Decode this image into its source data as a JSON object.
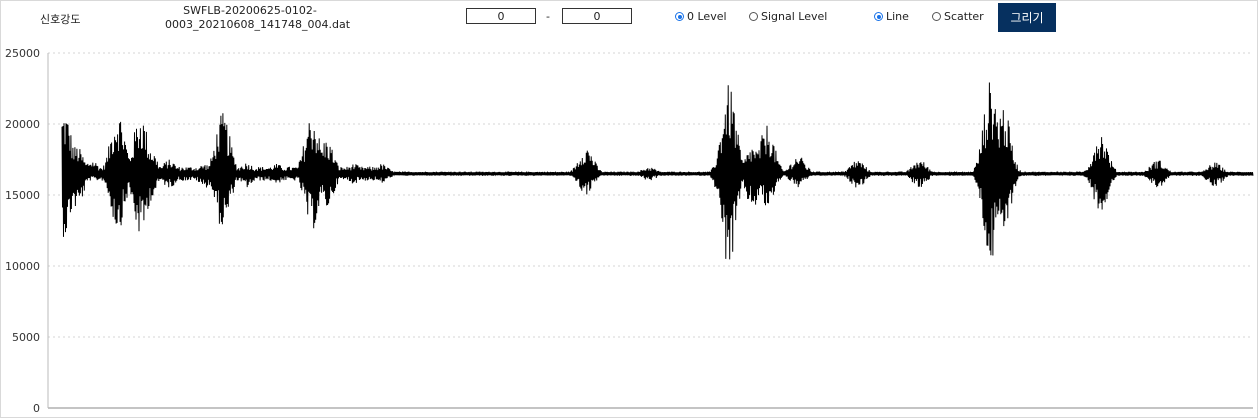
{
  "toolbar": {
    "title_label": "신호강도",
    "filename_line1": "SWFLB-20200625-0102-",
    "filename_line2": "0003_20210608_141748_004.dat",
    "range_start": "0",
    "range_separator": "-",
    "range_end": "0",
    "level_options": [
      "0 Level",
      "Signal Level"
    ],
    "level_selected": "0 Level",
    "plot_options": [
      "Line",
      "Scatter"
    ],
    "plot_selected": "Line",
    "draw_button": "그리기"
  },
  "colors": {
    "button_bg": "#06305f",
    "radio_checked": "#1a73e8",
    "signal": "#000000"
  },
  "chart_data": {
    "type": "line",
    "xlabel": "",
    "ylabel": "",
    "ylim": [
      0,
      25000
    ],
    "yticks": [
      "0",
      "5000",
      "10000",
      "15000",
      "20000",
      "25000"
    ],
    "grid": "horizontal-dotted",
    "baseline": 16500,
    "x_range": [
      0,
      1000
    ],
    "bursts": [
      {
        "x": 2,
        "min": 12000,
        "max": 21000
      },
      {
        "x": 12,
        "min": 14000,
        "max": 18500
      },
      {
        "x": 25,
        "min": 16000,
        "max": 17500
      },
      {
        "x": 47,
        "min": 12500,
        "max": 21000
      },
      {
        "x": 53,
        "min": 15500,
        "max": 17500
      },
      {
        "x": 66,
        "min": 12000,
        "max": 20800
      },
      {
        "x": 73,
        "min": 14500,
        "max": 18500
      },
      {
        "x": 90,
        "min": 15500,
        "max": 17500
      },
      {
        "x": 120,
        "min": 15500,
        "max": 17200
      },
      {
        "x": 135,
        "min": 12500,
        "max": 20800
      },
      {
        "x": 155,
        "min": 15500,
        "max": 17300
      },
      {
        "x": 180,
        "min": 15800,
        "max": 17200
      },
      {
        "x": 210,
        "min": 12500,
        "max": 20800
      },
      {
        "x": 222,
        "min": 14000,
        "max": 19000
      },
      {
        "x": 245,
        "min": 15800,
        "max": 17200
      },
      {
        "x": 268,
        "min": 15800,
        "max": 17200
      },
      {
        "x": 440,
        "min": 15000,
        "max": 18500
      },
      {
        "x": 493,
        "min": 16000,
        "max": 17000
      },
      {
        "x": 560,
        "min": 9700,
        "max": 22800
      },
      {
        "x": 580,
        "min": 14000,
        "max": 18500
      },
      {
        "x": 592,
        "min": 14000,
        "max": 20000
      },
      {
        "x": 618,
        "min": 15500,
        "max": 17800
      },
      {
        "x": 668,
        "min": 15500,
        "max": 17500
      },
      {
        "x": 720,
        "min": 15500,
        "max": 17500
      },
      {
        "x": 780,
        "min": 10000,
        "max": 23200
      },
      {
        "x": 790,
        "min": 12000,
        "max": 21500
      },
      {
        "x": 872,
        "min": 13800,
        "max": 19500
      },
      {
        "x": 920,
        "min": 15500,
        "max": 17500
      },
      {
        "x": 968,
        "min": 15500,
        "max": 17300
      }
    ]
  }
}
